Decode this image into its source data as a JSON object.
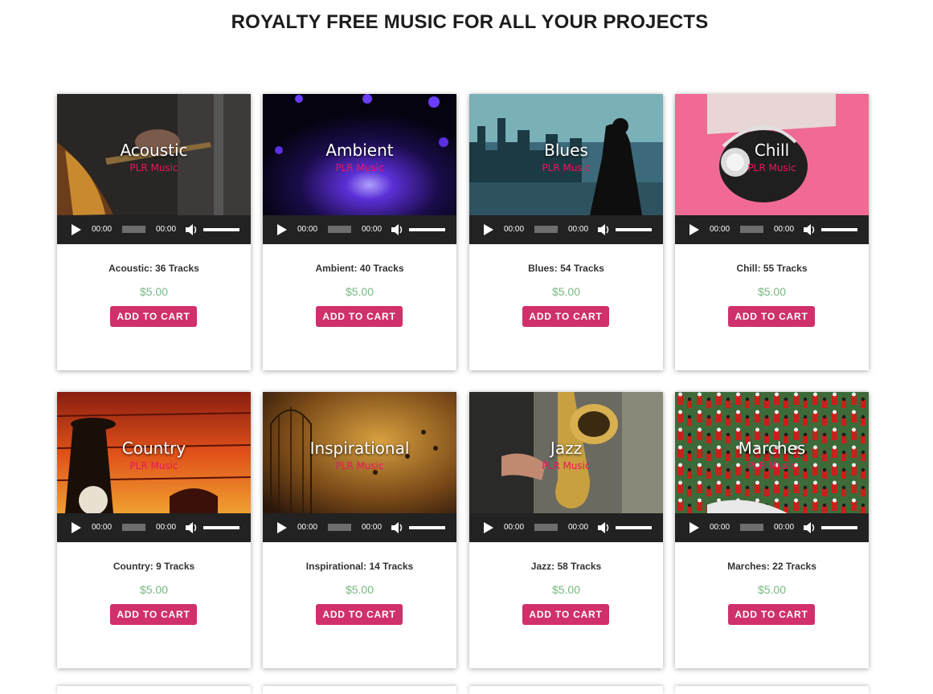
{
  "page": {
    "title": "ROYALTY FREE MUSIC FOR ALL YOUR PROJECTS"
  },
  "colors": {
    "accent": "#d0306b",
    "brand_text": "#e8175d",
    "price": "#77b880",
    "player_bg": "#222222"
  },
  "products": [
    {
      "genre": "Acoustic",
      "brand": "PLR Music",
      "time_current": "00:00",
      "time_total": "00:00",
      "tracks_label": "Acoustic: 36 Tracks",
      "price": "$5.00",
      "button": "ADD TO CART"
    },
    {
      "genre": "Ambient",
      "brand": "PLR Music",
      "time_current": "00:00",
      "time_total": "00:00",
      "tracks_label": "Ambient: 40 Tracks",
      "price": "$5.00",
      "button": "ADD TO CART"
    },
    {
      "genre": "Blues",
      "brand": "PLR Music",
      "time_current": "00:00",
      "time_total": "00:00",
      "tracks_label": "Blues: 54 Tracks",
      "price": "$5.00",
      "button": "ADD TO CART"
    },
    {
      "genre": "Chill",
      "brand": "PLR Music",
      "time_current": "00:00",
      "time_total": "00:00",
      "tracks_label": "Chill: 55 Tracks",
      "price": "$5.00",
      "button": "ADD TO CART"
    },
    {
      "genre": "Country",
      "brand": "PLR Music",
      "time_current": "00:00",
      "time_total": "00:00",
      "tracks_label": "Country: 9 Tracks",
      "price": "$5.00",
      "button": "ADD TO CART"
    },
    {
      "genre": "Inspirational",
      "brand": "PLR Music",
      "time_current": "00:00",
      "time_total": "00:00",
      "tracks_label": "Inspirational: 14 Tracks",
      "price": "$5.00",
      "button": "ADD TO CART"
    },
    {
      "genre": "Jazz",
      "brand": "PLR Music",
      "time_current": "00:00",
      "time_total": "00:00",
      "tracks_label": "Jazz: 58 Tracks",
      "price": "$5.00",
      "button": "ADD TO CART"
    },
    {
      "genre": "Marches",
      "brand": "PLR Music",
      "time_current": "00:00",
      "time_total": "00:00",
      "tracks_label": "Marches: 22 Tracks",
      "price": "$5.00",
      "button": "ADD TO CART"
    }
  ]
}
